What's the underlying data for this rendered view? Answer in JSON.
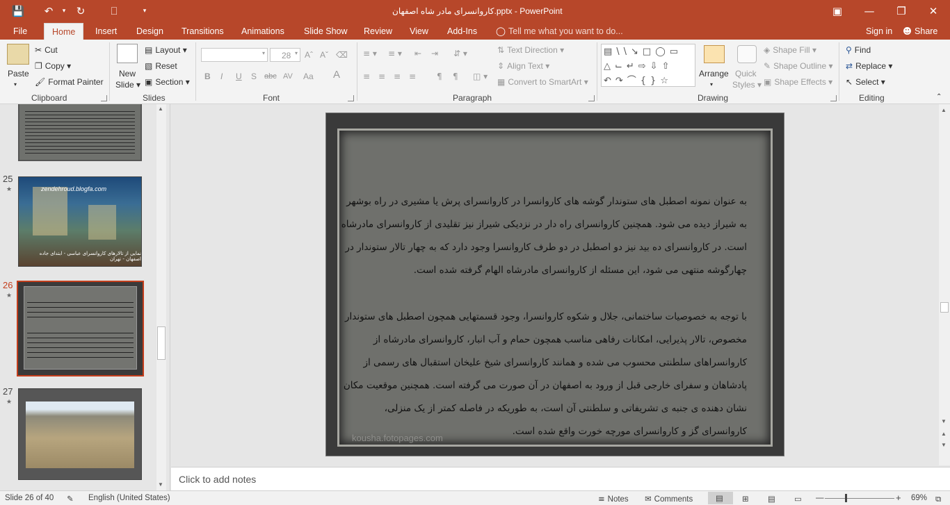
{
  "titlebar": {
    "title": "کاروانسرای مادر شاه اصفهان.pptx - PowerPoint"
  },
  "tabs": [
    "File",
    "Home",
    "Insert",
    "Design",
    "Transitions",
    "Animations",
    "Slide Show",
    "Review",
    "View",
    "Add-Ins"
  ],
  "tell_me": "Tell me what you want to do...",
  "account": {
    "sign_in": "Sign in",
    "share": "Share"
  },
  "clipboard": {
    "paste": "Paste",
    "cut": "Cut",
    "copy": "Copy",
    "format_painter": "Format Painter",
    "label": "Clipboard"
  },
  "slides_group": {
    "new_slide": "New",
    "new_slide2": "Slide",
    "layout": "Layout",
    "reset": "Reset",
    "section": "Section",
    "label": "Slides"
  },
  "font": {
    "size": "28",
    "label": "Font",
    "buttons": [
      "B",
      "I",
      "U",
      "S",
      "abc",
      "AV",
      "Aa",
      "A"
    ]
  },
  "paragraph": {
    "text_direction": "Text Direction",
    "align_text": "Align Text",
    "smartart": "Convert to SmartArt",
    "label": "Paragraph"
  },
  "drawing": {
    "arrange": "Arrange",
    "quick": "Quick",
    "styles": "Styles",
    "shape_fill": "Shape Fill",
    "shape_outline": "Shape Outline",
    "shape_effects": "Shape Effects",
    "label": "Drawing"
  },
  "editing": {
    "find": "Find",
    "replace": "Replace",
    "select": "Select",
    "label": "Editing"
  },
  "thumbnails": [
    {
      "num": "25",
      "caption": "zendehroud.blogfa.com",
      "bottom": "نمایی از تالارهای کاروانسرای عباسی - ابتدای جاده اصفهان - تهران"
    },
    {
      "num": "26"
    },
    {
      "num": "27"
    }
  ],
  "slide": {
    "para1": "به عنوان نمونه اصطبل های ستوندار گوشه های کاروانسرا در کاروانسرای پرش یا مشیری در راه بوشهر به شیراز دیده می شود. همچنین کاروانسرای راه دار در نزدیکی شیراز نیز تقلیدی از کاروانسرای مادرشاه است. در کاروانسرای ده بید نیز دو اصطبل در دو طرف کاروانسرا وجود دارد که به چهار تالار ستوندار در چهارگوشه منتهی می شود، این مسئله از کاروانسرای مادرشاه الهام گرفته شده است.",
    "para2": "با توجه به خصوصیات ساختمانی، جلال و شکوه کاروانسرا، وجود قسمتهایی همچون اصطبل های ستوندار مخصوص، تالار پذیرایی، امکانات رفاهی مناسب همچون حمام و آب انبار، کاروانسرای مادرشاه از کاروانسراهای سلطنتی محسوب می شده و همانند کاروانسرای شیخ علیخان استقبال های رسمی از پادشاهان و سفرای خارجی قبل از ورود به اصفهان در آن صورت می گرفته است. همچنین موقعیت مکان نشان دهنده ی جنبه ی تشریفاتی و سلطنتی آن است، به طوریکه در فاصله کمتر از یک منزلی، کاروانسرای گز و کاروانسرای مورچه خورت واقع شده است.",
    "watermark": "kousha.fotopages.com"
  },
  "notes_placeholder": "Click to add notes",
  "status": {
    "slide": "Slide 26 of 40",
    "language": "English (United States)",
    "notes": "Notes",
    "comments": "Comments",
    "zoom": "69%"
  }
}
